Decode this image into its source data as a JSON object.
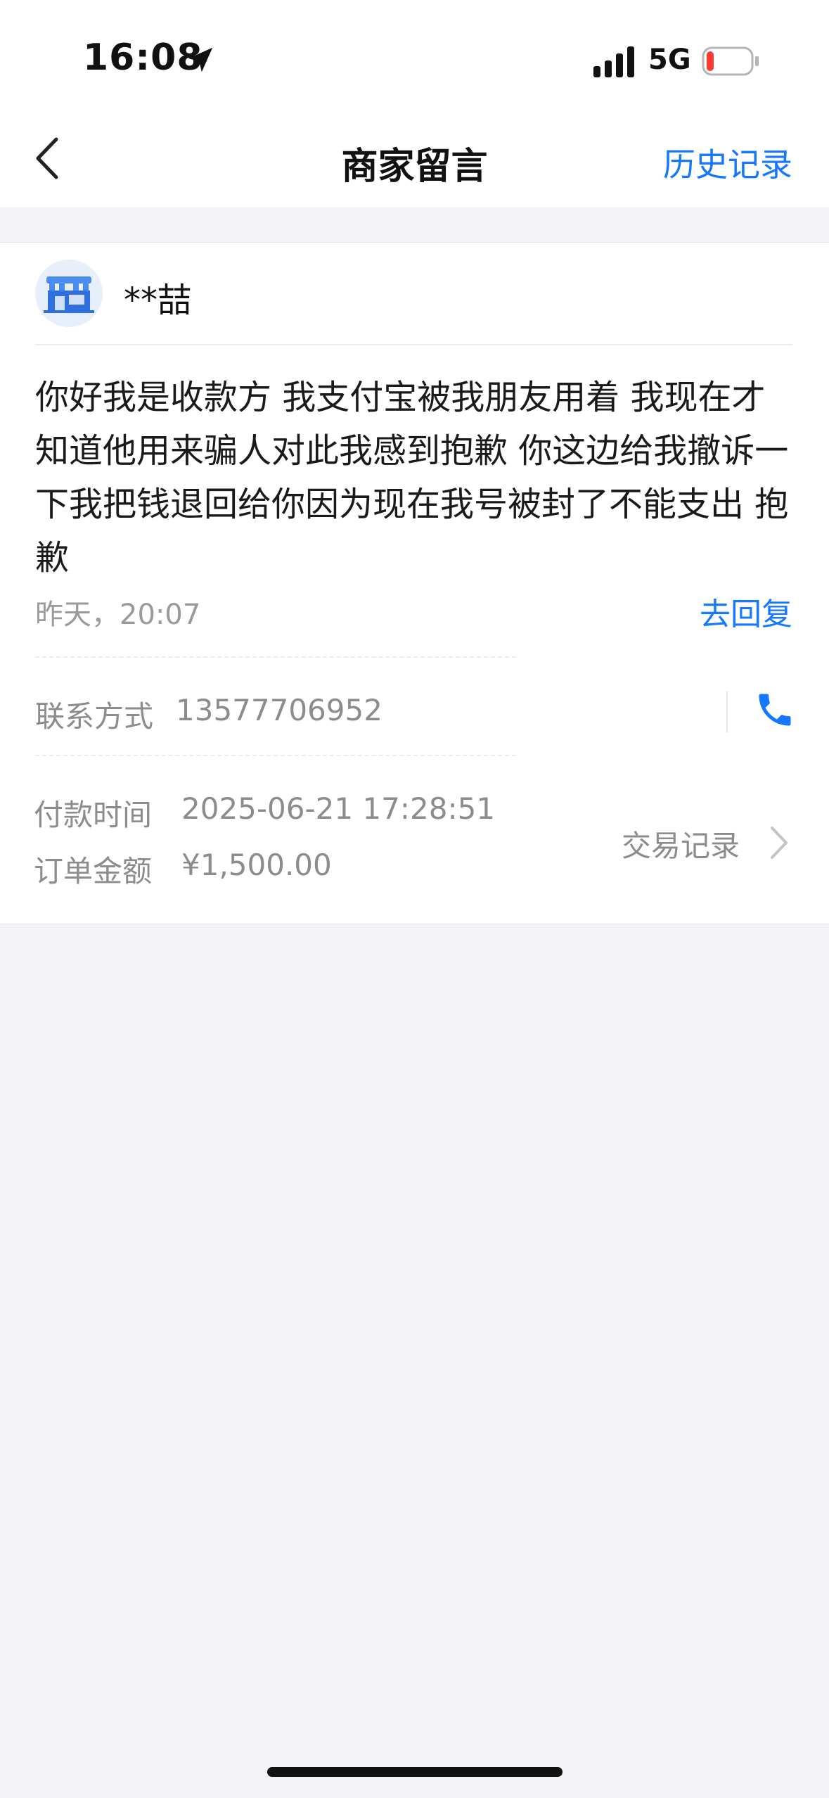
{
  "status_bar": {
    "time": "16:08",
    "network": "5G",
    "icons": [
      "location-arrow-icon",
      "signal-icon",
      "battery-low-icon"
    ],
    "battery_color": "#ff3b30"
  },
  "nav": {
    "title": "商家留言",
    "history_label": "历史记录",
    "accent_color": "#1677ff"
  },
  "message": {
    "sender_name": "**喆",
    "text": "你好我是收款方 我支付宝被我朋友用着 我现在才知道他用来骗人对此我感到抱歉 你这边给我撤诉一下我把钱退回给你因为现在我号被封了不能支出 抱歉",
    "time": "昨天，20:07",
    "reply_label": "去回复"
  },
  "contact": {
    "label": "联系方式",
    "phone": "13577706952"
  },
  "order": {
    "pay_time_label": "付款时间",
    "pay_time": "2025-06-21 17:28:51",
    "amount_label": "订单金额",
    "amount": "¥1,500.00",
    "tx_record_label": "交易记录"
  }
}
